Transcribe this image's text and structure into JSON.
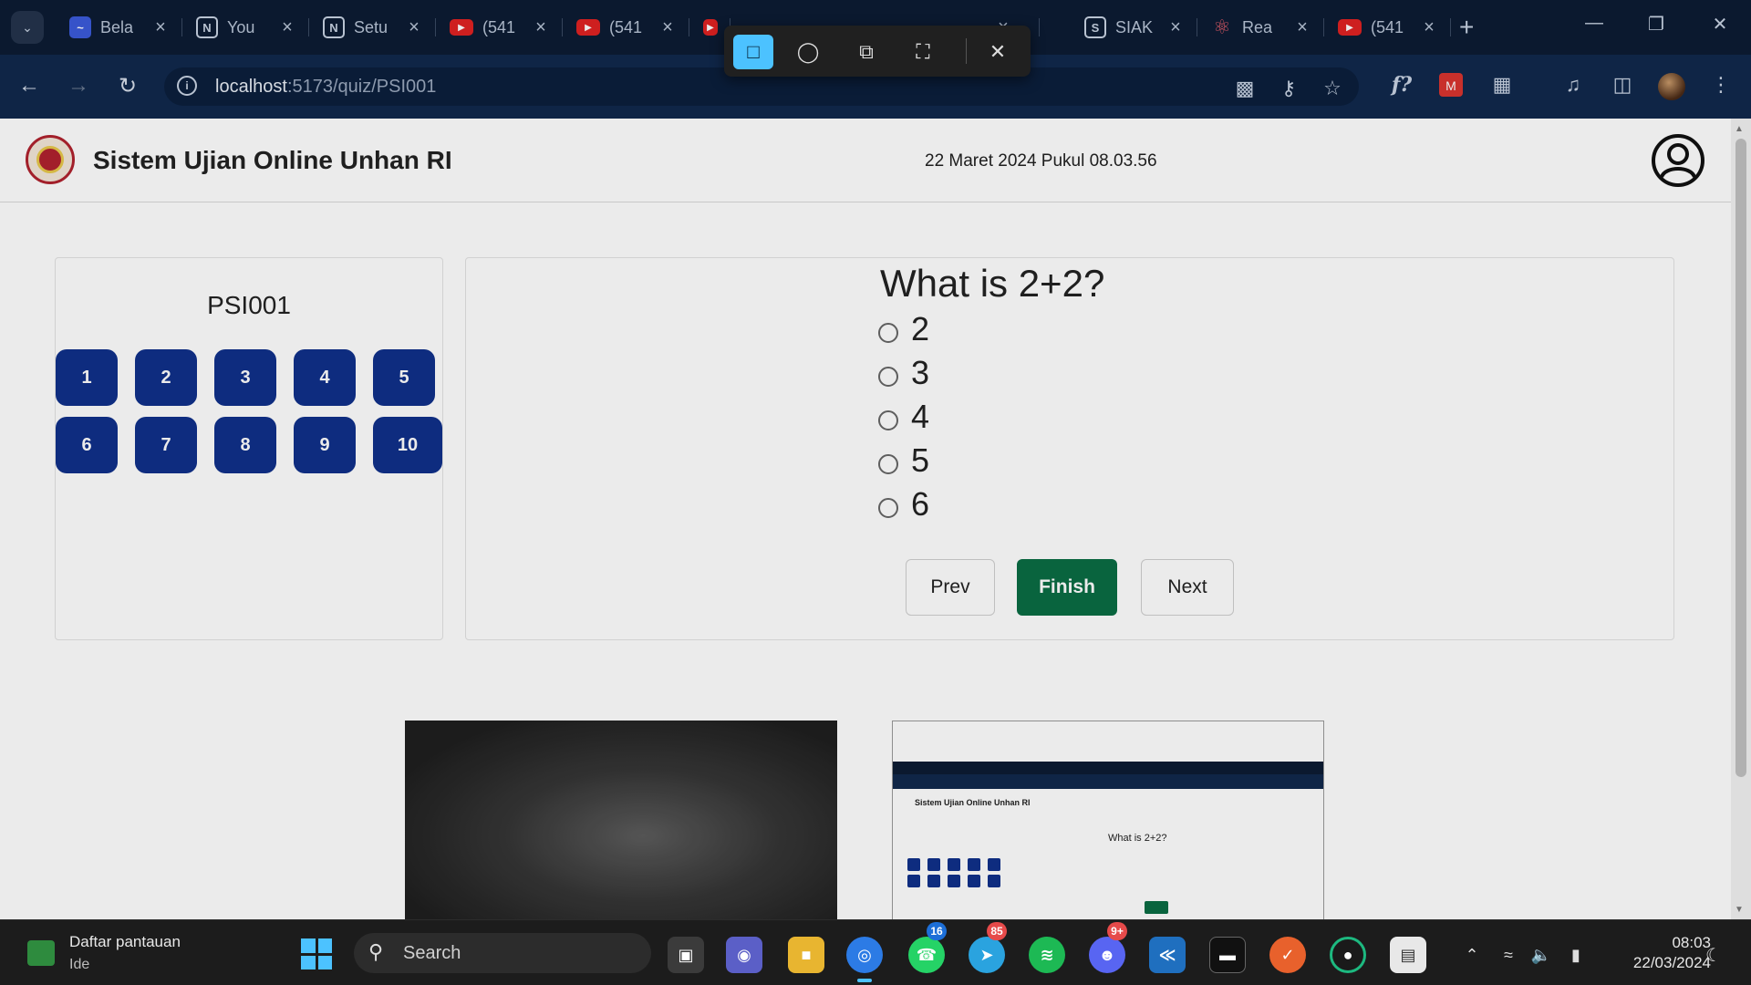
{
  "browser": {
    "tabs": [
      {
        "label": "Bela",
        "icon": "wave-icon"
      },
      {
        "label": "You",
        "icon": "notion-icon"
      },
      {
        "label": "Setu",
        "icon": "notion-icon"
      },
      {
        "label": "(541",
        "icon": "youtube-icon"
      },
      {
        "label": "(541",
        "icon": "youtube-icon"
      },
      {
        "label": "",
        "icon": "youtube-icon"
      },
      {
        "label": "SIAK",
        "icon": "siak-icon"
      },
      {
        "label": "Rea",
        "icon": "react-icon"
      },
      {
        "label": "(541",
        "icon": "youtube-icon"
      }
    ],
    "url_host": "localhost",
    "url_path": ":5173/quiz/PSI001"
  },
  "app": {
    "title": "Sistem Ujian Online Unhan RI",
    "datetime": "22 Maret 2024 Pukul 08.03.56"
  },
  "quiz": {
    "code": "PSI001",
    "numbers": [
      "1",
      "2",
      "3",
      "4",
      "5",
      "6",
      "7",
      "8",
      "9",
      "10"
    ],
    "question": "What is 2+2?",
    "options": [
      "2",
      "3",
      "4",
      "5",
      "6"
    ],
    "prev_label": "Prev",
    "finish_label": "Finish",
    "next_label": "Next"
  },
  "preview": {
    "title": "Sistem Ujian Online Unhan RI",
    "question": "What is 2+2?"
  },
  "taskbar": {
    "weather_title": "Daftar pantauan",
    "weather_sub": "Ide",
    "search_placeholder": "Search",
    "badges": {
      "whatsapp": "16",
      "telegram": "85",
      "discord": "9+"
    },
    "time": "08:03",
    "date": "22/03/2024"
  },
  "colors": {
    "question_button": "#10308a",
    "finish_button": "#0a6d44",
    "accent": "#4cc2ff"
  }
}
